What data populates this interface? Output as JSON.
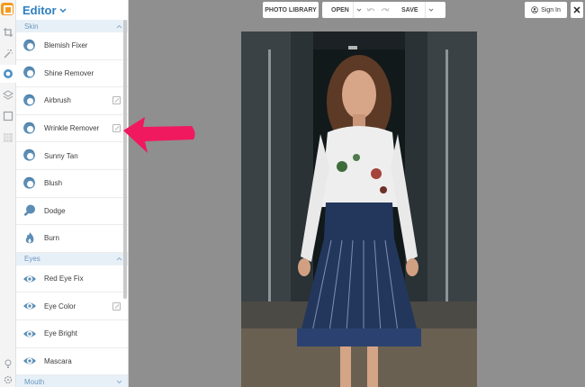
{
  "toolbar": {
    "photo_library_label": "PHOTO LIBRARY",
    "open_label": "OPEN",
    "save_label": "SAVE",
    "sign_in_label": "Sign In",
    "close_label": "✕"
  },
  "panel": {
    "title": "Editor",
    "sections": [
      {
        "title": "Skin",
        "items": [
          {
            "label": "Blemish Fixer",
            "icon": "face-icon"
          },
          {
            "label": "Shine Remover",
            "icon": "face-icon"
          },
          {
            "label": "Airbrush",
            "icon": "face-icon"
          },
          {
            "label": "Wrinkle Remover",
            "icon": "face-icon"
          },
          {
            "label": "Sunny Tan",
            "icon": "face-icon"
          },
          {
            "label": "Blush",
            "icon": "face-icon"
          },
          {
            "label": "Dodge",
            "icon": "magnifier-icon"
          },
          {
            "label": "Burn",
            "icon": "flame-icon"
          }
        ]
      },
      {
        "title": "Eyes",
        "items": [
          {
            "label": "Red Eye Fix",
            "icon": "eye-icon"
          },
          {
            "label": "Eye Color",
            "icon": "eye-icon"
          },
          {
            "label": "Eye Bright",
            "icon": "eye-icon"
          },
          {
            "label": "Mascara",
            "icon": "eye-icon"
          }
        ]
      },
      {
        "title": "Mouth",
        "items": []
      }
    ]
  },
  "colors": {
    "accent": "#2d7fc1",
    "arrow": "#f0195f",
    "workspace": "#8f8f8f"
  }
}
